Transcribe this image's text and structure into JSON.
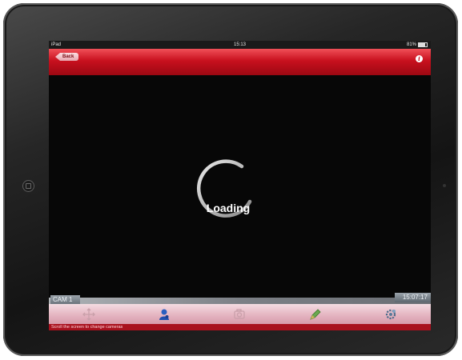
{
  "status_bar": {
    "carrier": "iPad",
    "time": "15:13",
    "battery": "81%"
  },
  "nav": {
    "back_label": "Back"
  },
  "video": {
    "loading_text": "Loading"
  },
  "camera": {
    "name": "CAM 1",
    "time": "15:07:17"
  },
  "toolbar": {
    "tools": [
      {
        "icon": "ptz-move-icon"
      },
      {
        "icon": "user-icon"
      },
      {
        "icon": "camera-switch-icon"
      },
      {
        "icon": "edit-pen-icon"
      },
      {
        "icon": "settings-icon"
      }
    ]
  },
  "hint": {
    "text": "Scroll the screen to change cameras"
  },
  "colors": {
    "nav_red": "#c8101e",
    "toolbar_pink": "#e6b8c4",
    "hint_red": "#a9111e"
  }
}
